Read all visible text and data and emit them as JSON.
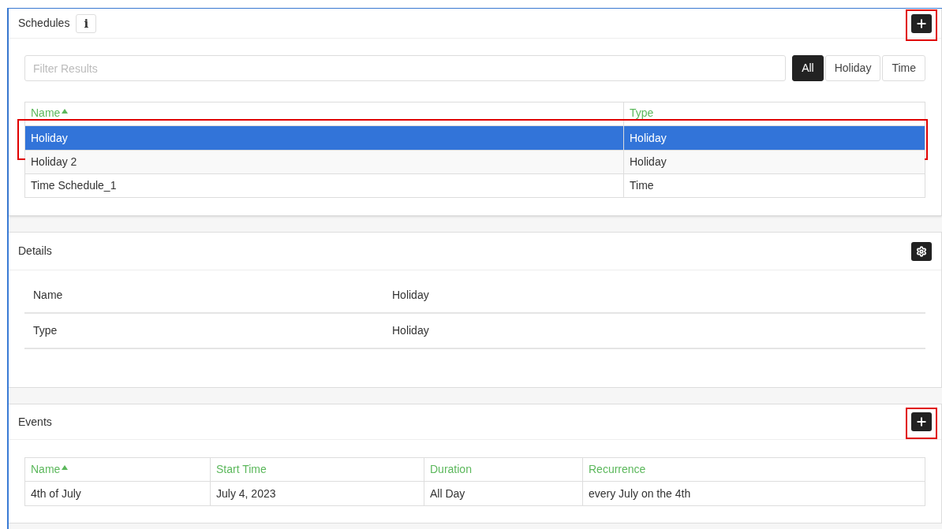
{
  "schedules": {
    "title": "Schedules",
    "info": "i",
    "add_annotated": true,
    "filter": {
      "placeholder": "Filter Results"
    },
    "filter_tabs": [
      {
        "label": "All",
        "selected": true
      },
      {
        "label": "Holiday",
        "selected": false
      },
      {
        "label": "Time",
        "selected": false
      }
    ],
    "columns": [
      {
        "label": "Name",
        "sorted": true
      },
      {
        "label": "Type",
        "sorted": false
      }
    ],
    "rows": [
      {
        "name": "Holiday",
        "type": "Holiday",
        "selected": true,
        "annotated": true
      },
      {
        "name": "Holiday 2",
        "type": "Holiday",
        "selected": false,
        "annotated": false
      },
      {
        "name": "Time Schedule_1",
        "type": "Time",
        "selected": false,
        "annotated": false
      }
    ]
  },
  "details": {
    "title": "Details",
    "fields": [
      {
        "label": "Name",
        "value": "Holiday"
      },
      {
        "label": "Type",
        "value": "Holiday"
      }
    ]
  },
  "events": {
    "title": "Events",
    "add_annotated": true,
    "columns": [
      {
        "label": "Name",
        "sorted": true
      },
      {
        "label": "Start Time",
        "sorted": false
      },
      {
        "label": "Duration",
        "sorted": false
      },
      {
        "label": "Recurrence",
        "sorted": false
      }
    ],
    "rows": [
      [
        "4th of July",
        "July 4, 2023",
        "All Day",
        "every July on the 4th"
      ]
    ]
  }
}
